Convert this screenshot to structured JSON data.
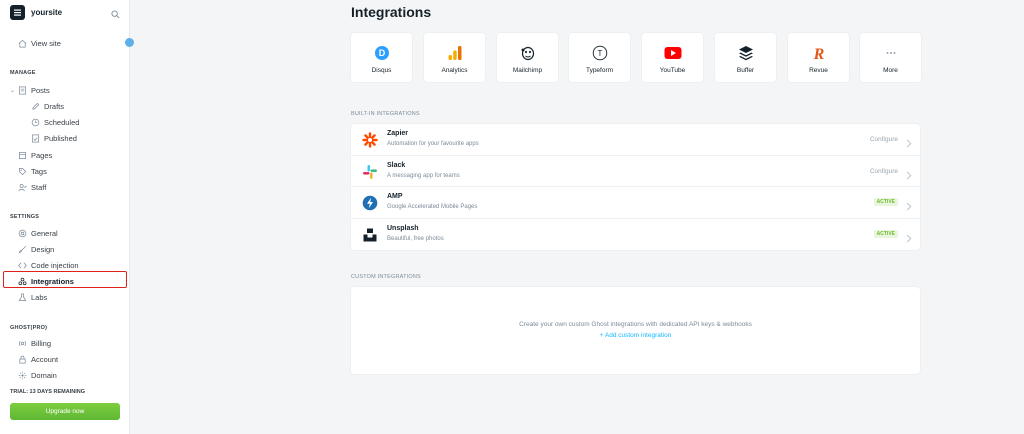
{
  "sidebar": {
    "site_name": "yoursite",
    "view_site": "View site",
    "manage_label": "MANAGE",
    "posts": "Posts",
    "drafts": "Drafts",
    "scheduled": "Scheduled",
    "published": "Published",
    "pages": "Pages",
    "tags": "Tags",
    "staff": "Staff",
    "settings_label": "SETTINGS",
    "general": "General",
    "design": "Design",
    "code_injection": "Code injection",
    "integrations": "Integrations",
    "labs": "Labs",
    "ghost_label": "GHOST(PRO)",
    "billing": "Billing",
    "account": "Account",
    "domain": "Domain",
    "trial": "TRIAL: 13 DAYS REMAINING",
    "upgrade": "Upgrade now"
  },
  "main": {
    "title": "Integrations",
    "tiles": [
      {
        "label": "Disqus",
        "icon": "disqus-icon"
      },
      {
        "label": "Analytics",
        "icon": "analytics-icon"
      },
      {
        "label": "Mailchimp",
        "icon": "mailchimp-icon"
      },
      {
        "label": "Typeform",
        "icon": "typeform-icon"
      },
      {
        "label": "YouTube",
        "icon": "youtube-icon"
      },
      {
        "label": "Buffer",
        "icon": "buffer-icon"
      },
      {
        "label": "Revue",
        "icon": "revue-icon"
      },
      {
        "label": "More",
        "icon": "more-icon"
      }
    ],
    "builtin_label": "BUILT-IN INTEGRATIONS",
    "builtin": [
      {
        "name": "Zapier",
        "desc": "Automation for your favourite apps",
        "action": "Configure"
      },
      {
        "name": "Slack",
        "desc": "A messaging app for teams",
        "action": "Configure"
      },
      {
        "name": "AMP",
        "desc": "Google Accelerated Mobile Pages",
        "action": "ACTIVE"
      },
      {
        "name": "Unsplash",
        "desc": "Beautiful, free photos",
        "action": "ACTIVE"
      }
    ],
    "custom_label": "CUSTOM INTEGRATIONS",
    "custom_message": "Create your own custom Ghost integrations with dedicated API keys & webhooks",
    "custom_link": "+ Add custom integration"
  },
  "colors": {
    "accent": "#14b8ff",
    "active_green": "#6cbf25",
    "upgrade_green": "#5fb734",
    "highlight_red": "#e0201b"
  }
}
